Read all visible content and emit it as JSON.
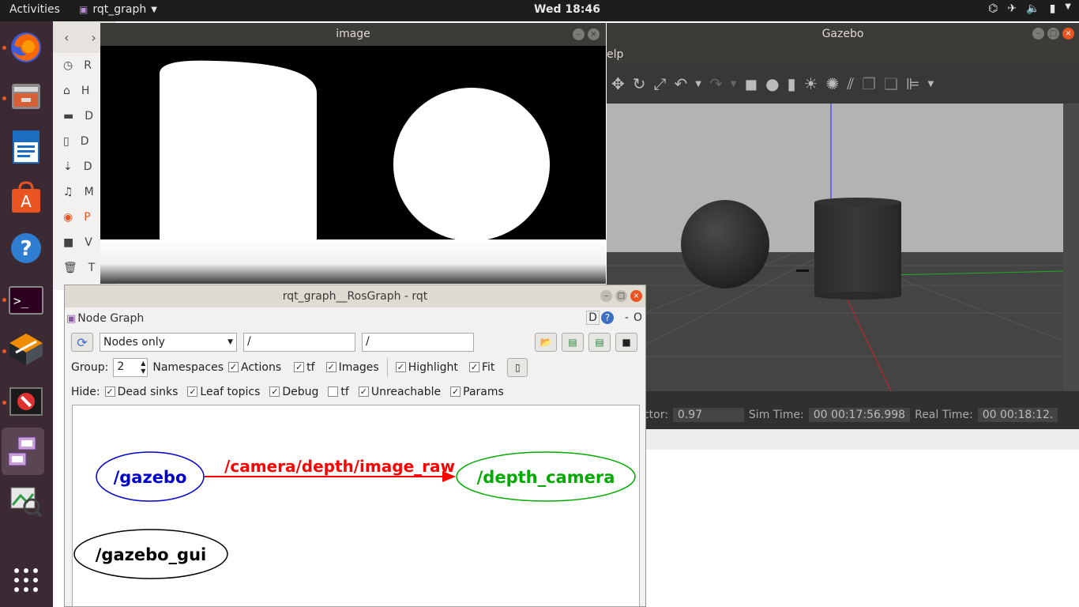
{
  "topbar": {
    "activities": "Activities",
    "app_name": "rqt_graph",
    "clock": "Wed 18:46"
  },
  "files": {
    "items": [
      "R",
      "H",
      "D",
      "D",
      "D",
      "M",
      "P",
      "V",
      "T"
    ]
  },
  "image_window": {
    "title": "image"
  },
  "gazebo": {
    "title": "Gazebo",
    "menu_help": "elp",
    "status": {
      "time_factor_label": "ime Factor:",
      "time_factor": "0.97",
      "sim_time_label": "Sim Time:",
      "sim_time": "00 00:17:56.998",
      "real_time_label": "Real Time:",
      "real_time": "00 00:18:12."
    }
  },
  "rqt": {
    "title": "rqt_graph__RosGraph - rqt",
    "plugin": "Node Graph",
    "header_right": {
      "d": "D",
      "dash": "-",
      "o": "O"
    },
    "mode": "Nodes only",
    "filter1": "/",
    "filter2": "/",
    "group_label": "Group:",
    "group_value": "2",
    "options": [
      {
        "label": "Namespaces",
        "checked": true
      },
      {
        "label": "Actions",
        "checked": true
      },
      {
        "label": "tf",
        "checked": true
      },
      {
        "label": "Images",
        "checked": true
      },
      {
        "label": "Highlight",
        "checked": true
      },
      {
        "label": "Fit",
        "checked": true
      }
    ],
    "hide_label": "Hide:",
    "hide": [
      {
        "label": "Dead sinks",
        "checked": true
      },
      {
        "label": "Leaf topics",
        "checked": true
      },
      {
        "label": "Debug",
        "checked": true
      },
      {
        "label": "tf",
        "checked": false
      },
      {
        "label": "Unreachable",
        "checked": true
      },
      {
        "label": "Params",
        "checked": true
      }
    ],
    "graph": {
      "nodes": [
        {
          "name": "/gazebo",
          "color": "#0000cc"
        },
        {
          "name": "/depth_camera",
          "color": "#00aa00"
        },
        {
          "name": "/gazebo_gui",
          "color": "#000000"
        }
      ],
      "topic": "/camera/depth/image_raw",
      "topic_color": "#ff0000"
    }
  }
}
